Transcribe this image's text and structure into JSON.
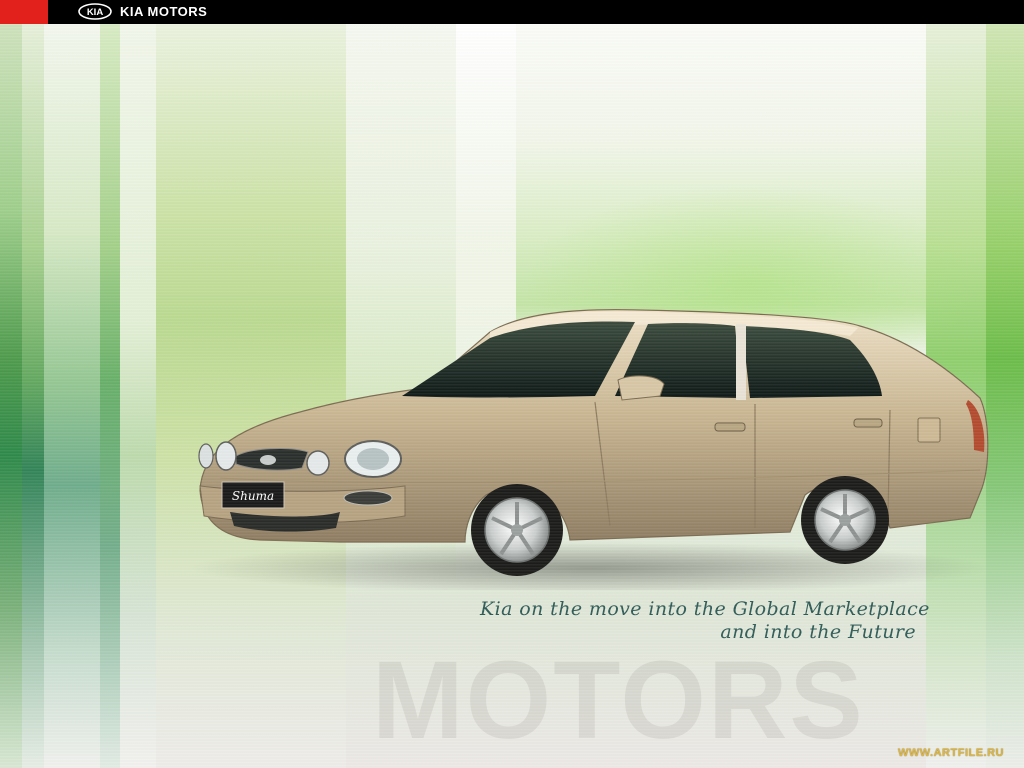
{
  "header": {
    "brand_text": "KIA MOTORS",
    "logo_text": "KIA",
    "red_accent": "#e2211c",
    "background": "#000000"
  },
  "hero": {
    "car_model_badge": "Shuma",
    "tagline_line1": "Kia on the move into the Global Marketplace",
    "tagline_line2": "and into the Future",
    "background_word": "MOTORS",
    "accent_green": "#7fc95a"
  },
  "watermark": {
    "text": "WWW.ARTFILE.RU"
  }
}
